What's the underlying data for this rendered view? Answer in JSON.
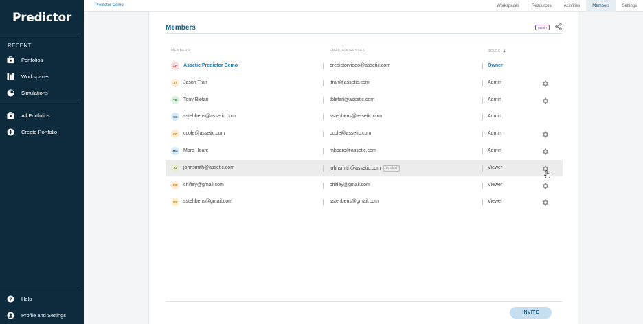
{
  "sidebar": {
    "brand": "Predictor",
    "recent_label": "RECENT",
    "recent_items": [
      {
        "label": "Portfolios",
        "icon": "portfolio-icon"
      },
      {
        "label": "Workspaces",
        "icon": "workspaces-icon"
      },
      {
        "label": "Simulations",
        "icon": "simulations-icon"
      }
    ],
    "items": [
      {
        "label": "All Portfolios",
        "icon": "portfolio-icon"
      },
      {
        "label": "Create Portfolio",
        "icon": "plus-circle-icon"
      }
    ],
    "footer_items": [
      {
        "label": "Help",
        "icon": "help-icon"
      },
      {
        "label": "Profile and Settings",
        "icon": "profile-icon"
      }
    ]
  },
  "topbar": {
    "breadcrumb": "Predictor Demo",
    "tabs": [
      "Workspaces",
      "Resources",
      "Activities",
      "Members",
      "Settings"
    ],
    "active_tab": "Members"
  },
  "main": {
    "title": "Members",
    "admin_badge": "Admin",
    "headers": {
      "members": "MEMBERS",
      "email": "EMAIL ADDRESSES",
      "roles": "ROLES"
    },
    "members": [
      {
        "initials": "AD",
        "name": "Assetic Predictor Demo",
        "email": "predictorvideo@assetic.com",
        "role": "Owner",
        "gear": false,
        "avatar_bg": "#f9dede",
        "avatar_fg": "#c0392b"
      },
      {
        "initials": "JT",
        "name": "Jason Tran",
        "email": "jtran@assetic.com",
        "role": "Admin",
        "gear": true,
        "avatar_bg": "#fdecd6",
        "avatar_fg": "#b36b00"
      },
      {
        "initials": "TB",
        "name": "Tony Blefari",
        "email": "tblefari@assetic.com",
        "role": "Admin",
        "gear": true,
        "avatar_bg": "#dbf0dc",
        "avatar_fg": "#2e7d32"
      },
      {
        "initials": "SS",
        "name": "sstehbens@assetic.com",
        "email": "sstehbens@assetic.com",
        "role": "Admin",
        "gear": false,
        "avatar_bg": "#d8e8f4",
        "avatar_fg": "#1f5f88"
      },
      {
        "initials": "CC",
        "name": "ccole@assetic.com",
        "email": "ccole@assetic.com",
        "role": "Admin",
        "gear": true,
        "avatar_bg": "#fdecd6",
        "avatar_fg": "#b36b00"
      },
      {
        "initials": "MH",
        "name": "Marc Hoare",
        "email": "mhoare@assetic.com",
        "role": "Admin",
        "gear": true,
        "avatar_bg": "#d8e8f4",
        "avatar_fg": "#1f5f88"
      },
      {
        "initials": "JJ",
        "name": "johnsmith@assetic.com",
        "email": "johnsmith@assetic.com",
        "invited": "Invited",
        "role": "Viewer",
        "gear": true,
        "avatar_bg": "#e8f0d4",
        "avatar_fg": "#5a7a1a"
      },
      {
        "initials": "CC",
        "name": "chifley@gmail.com",
        "email": "chifley@gmail.com",
        "role": "Viewer",
        "gear": true,
        "avatar_bg": "#fdecd6",
        "avatar_fg": "#b36b00"
      },
      {
        "initials": "SS",
        "name": "sstehbens@gmail.com",
        "email": "sstehbens@gmail.com",
        "role": "Viewer",
        "gear": true,
        "avatar_bg": "#fdf0c8",
        "avatar_fg": "#a07800"
      }
    ],
    "invite_label": "INVITE"
  },
  "colors": {
    "sidebar_bg": "#0e2a3d",
    "accent": "#1f5f88",
    "invite_bg": "#c5dff0"
  }
}
